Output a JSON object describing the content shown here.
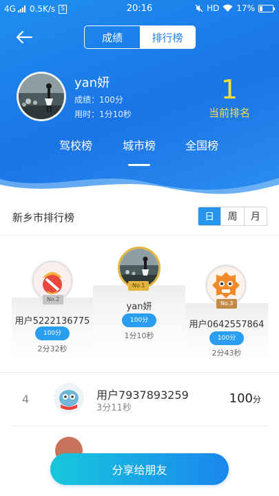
{
  "status_bar": {
    "network": "4G",
    "speed": "0.5K/s",
    "speed_badge": "S",
    "time": "20:16",
    "hd": "HD",
    "battery": "17%"
  },
  "nav": {
    "tabs": [
      "成绩",
      "排行榜"
    ],
    "active_tab": "排行榜"
  },
  "user": {
    "name": "yan妍",
    "score_line": "成绩：100分",
    "time_line": "用时：1分10秒",
    "rank": "1",
    "rank_label": "当前排名"
  },
  "board_tabs": [
    "驾校榜",
    "城市榜",
    "全国榜"
  ],
  "active_board_tab": "城市榜",
  "section": {
    "title": "新乡市排行榜",
    "periods": [
      "日",
      "周",
      "月"
    ],
    "active_period": "日"
  },
  "podium": [
    {
      "place": "No.1",
      "name": "yan妍",
      "score": "100分",
      "time": "1分10秒"
    },
    {
      "place": "No.2",
      "name": "用户5222136775",
      "score": "100分",
      "time": "2分32秒"
    },
    {
      "place": "No.3",
      "name": "用户0642557864",
      "score": "100分",
      "time": "2分43秒"
    }
  ],
  "list": [
    {
      "rank": "4",
      "name": "用户7937893259",
      "time": "3分11秒",
      "score": "100",
      "unit": "分"
    }
  ],
  "share_button": "分享给朋友",
  "colors": {
    "header_blue": "#1a7ee8",
    "accent_yellow": "#ffdf3d",
    "pill_blue": "#2a9ef0",
    "gold": "#e3b53e",
    "silver": "#c4c4c4",
    "bronze": "#c48a4a"
  },
  "icons": [
    "back-arrow-icon",
    "signal-icon",
    "mute-icon",
    "wifi-icon",
    "battery-icon"
  ]
}
